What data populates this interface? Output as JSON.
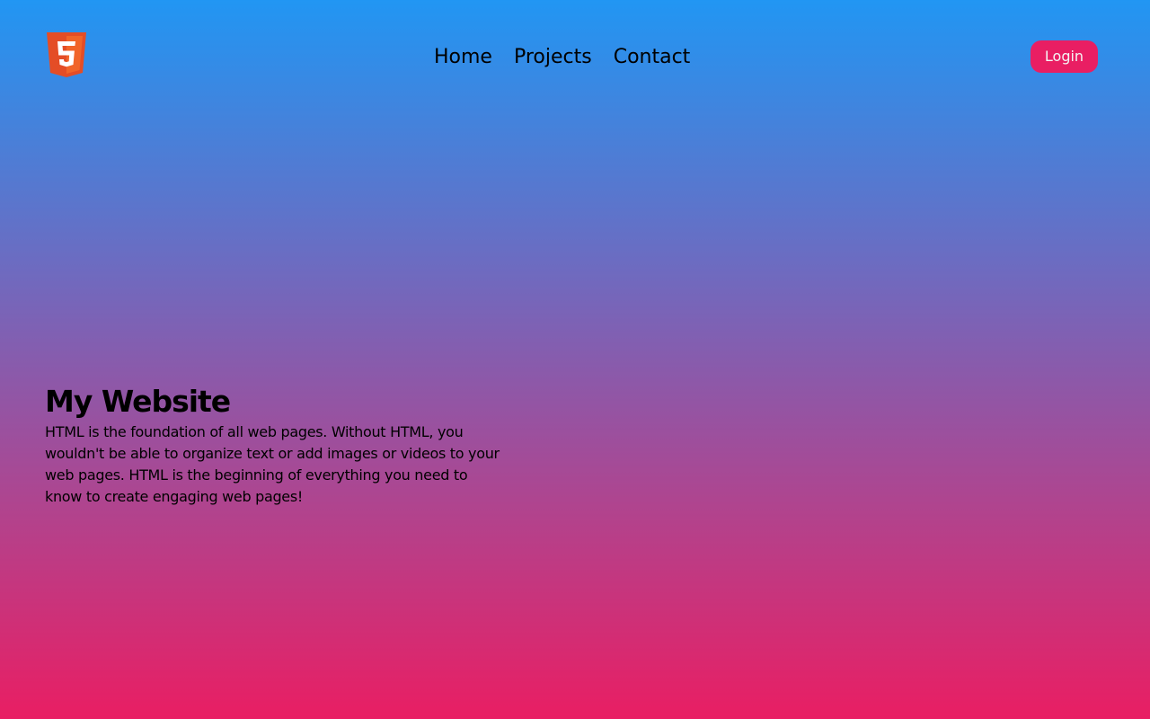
{
  "header": {
    "logo_icon": "html5-logo-icon",
    "logo_colors": {
      "shield": "#e44d26",
      "inner": "#f16529",
      "glyph": "#ffffff"
    },
    "nav": [
      {
        "label": "Home"
      },
      {
        "label": "Projects"
      },
      {
        "label": "Contact"
      }
    ],
    "login_label": "Login",
    "login_color": "#e91e63"
  },
  "hero": {
    "title": "My Website",
    "text": "HTML is the foundation of all web pages. Without HTML, you wouldn't be able to organize text or add images or videos to your web pages. HTML is the beginning of everything you need to know to create engaging web pages!"
  },
  "theme": {
    "gradient_top": "#2196f3",
    "gradient_bottom": "#e91e63"
  }
}
